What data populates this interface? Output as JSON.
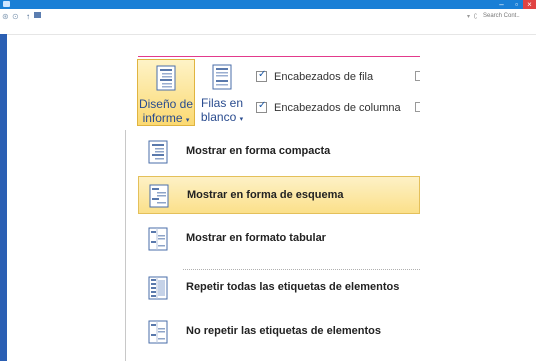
{
  "window": {
    "minimize": "–",
    "maximize": "▫",
    "close": "×"
  },
  "nav": {
    "search_placeholder": "Search Cont..",
    "back": "⊛",
    "forward": "⊙",
    "up": "↑",
    "refresh": "ʗ",
    "dropdown": "▾"
  },
  "ribbon": {
    "report_layout": {
      "line1": "Diseño de",
      "line2": "informe",
      "arrow": "▾"
    },
    "blank_rows": {
      "line1": "Filas en",
      "line2": "blanco",
      "arrow": "▾"
    },
    "row_headers": {
      "label": "Encabezados de fila",
      "checked": true
    },
    "column_headers": {
      "label": "Encabezados de columna",
      "checked": true
    }
  },
  "menu": {
    "items": [
      {
        "label": "Mostrar en forma compacta",
        "underline": "M",
        "icon": "compact-form-icon",
        "highlighted": false
      },
      {
        "label": "Mostrar en forma de esquema",
        "underline": "M",
        "icon": "outline-form-icon",
        "highlighted": true
      },
      {
        "label": "Mostrar en formato tabular",
        "underline": "M",
        "icon": "tabular-form-icon",
        "highlighted": false
      },
      {
        "label": "Repetir todas las etiquetas de elementos",
        "underline": "R",
        "icon": "repeat-labels-icon",
        "highlighted": false
      },
      {
        "label": "No repetir las etiquetas de elementos",
        "underline": "N",
        "icon": "no-repeat-labels-icon",
        "highlighted": false
      }
    ]
  },
  "colors": {
    "accent": "#e33a8c",
    "titlebar": "#1a7fd6",
    "highlight": "#fbe08a"
  }
}
